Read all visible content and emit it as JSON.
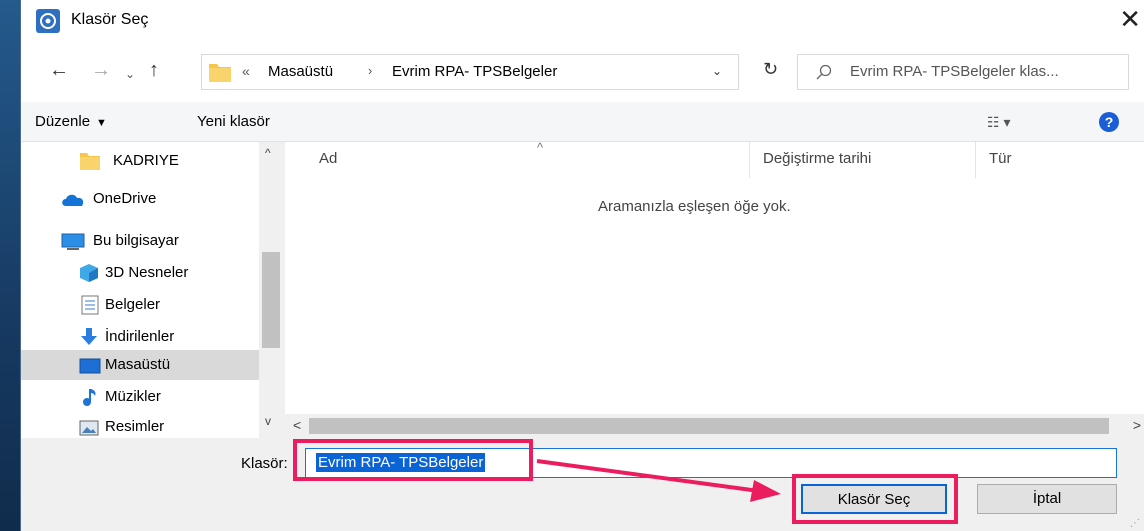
{
  "dialog": {
    "title": "Klasör Seç",
    "close_symbol": "✕"
  },
  "nav": {
    "back_symbol": "←",
    "forward_symbol": "→",
    "recent_symbol": "⌄",
    "up_symbol": "↑",
    "address": {
      "overflow": "«",
      "segments": [
        "Masaüstü",
        "Evrim RPA- TPSBelgeler"
      ],
      "chevron": "›",
      "dropdown_symbol": "⌄"
    },
    "refresh_symbol": "↻",
    "search_placeholder": "Evrim RPA- TPSBelgeler klas..."
  },
  "toolbar": {
    "organize_label": "Düzenle",
    "organize_caret": "▼",
    "new_folder_label": "Yeni klasör",
    "view_symbol": "☷ ▾",
    "help_symbol": "?"
  },
  "tree": {
    "items": [
      {
        "label": "KADRIYE",
        "icon": "folder-icon"
      },
      {
        "label": "OneDrive",
        "icon": "cloud-icon"
      },
      {
        "label": "Bu bilgisayar",
        "icon": "computer-icon"
      },
      {
        "label": "3D Nesneler",
        "icon": "cube-icon"
      },
      {
        "label": "Belgeler",
        "icon": "document-icon"
      },
      {
        "label": "İndirilenler",
        "icon": "download-icon"
      },
      {
        "label": "Masaüstü",
        "icon": "desktop-icon",
        "selected": true
      },
      {
        "label": "Müzikler",
        "icon": "music-icon"
      },
      {
        "label": "Resimler",
        "icon": "pictures-icon"
      }
    ],
    "scroll_up": "^",
    "scroll_down": "v"
  },
  "filelist": {
    "columns": [
      "Ad",
      "Değiştirme tarihi",
      "Tür"
    ],
    "sort_symbol": "^",
    "empty_message": "Aramanızla eşleşen öğe yok.",
    "scroll_left": "<",
    "scroll_right": ">"
  },
  "footer": {
    "folder_label": "Klasör:",
    "folder_value": "Evrim RPA- TPSBelgeler",
    "select_button": "Klasör Seç",
    "cancel_button": "İptal"
  },
  "colors": {
    "highlight": "#ec1d5f",
    "accent": "#0a64d6",
    "folder_yellow": "#f6c64a"
  }
}
